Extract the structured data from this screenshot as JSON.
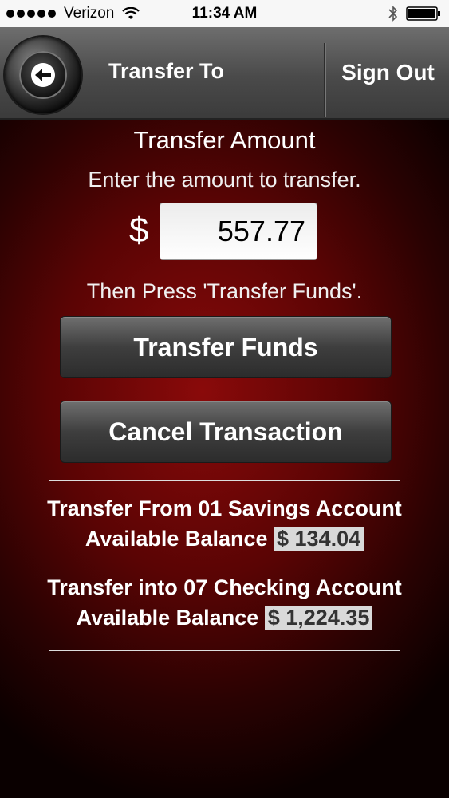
{
  "status_bar": {
    "carrier": "Verizon",
    "time": "11:34 AM",
    "icons": [
      "signal-dots-icon",
      "wifi-icon",
      "bluetooth-icon",
      "battery-icon"
    ]
  },
  "nav": {
    "title": "Transfer To",
    "sign_out_label": "Sign Out",
    "back_icon": "back-arrow-icon"
  },
  "form": {
    "heading": "Transfer Amount",
    "instruction": "Enter the amount to transfer.",
    "currency_symbol": "$",
    "amount_value": "557.77",
    "then_press": "Then Press 'Transfer Funds'.",
    "transfer_button": "Transfer Funds",
    "cancel_button": "Cancel Transaction"
  },
  "accounts": {
    "from_title": "Transfer From 01 Savings Account",
    "from_balance_label": "Available Balance",
    "from_balance_value": "$ 134.04",
    "into_title": "Transfer into 07 Checking Account",
    "into_balance_label": "Available Balance",
    "into_balance_value": "$ 1,224.35"
  },
  "colors": {
    "background_red": "#8a0a0a",
    "nav_gray": "#4a4a4a",
    "balance_chip": "#d9d9d9"
  }
}
